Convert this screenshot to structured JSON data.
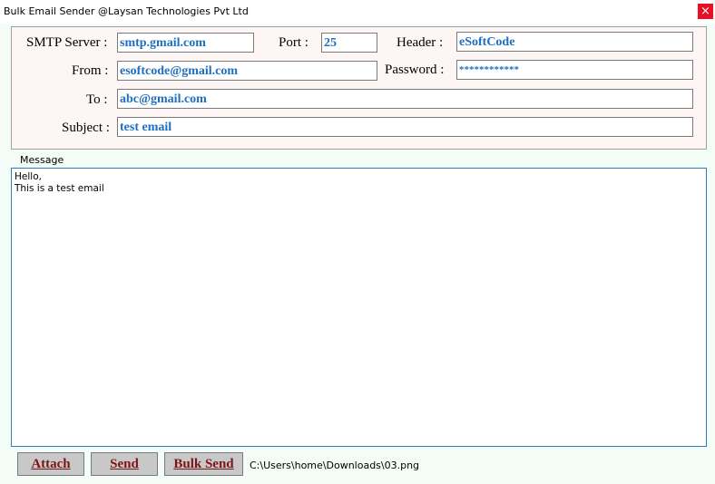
{
  "window": {
    "title": "Bulk Email Sender @Laysan Technologies Pvt Ltd",
    "close_glyph": "×"
  },
  "form": {
    "smtp_label": "SMTP Server :",
    "smtp_value": "smtp.gmail.com",
    "port_label": "Port :",
    "port_value": "25",
    "header_label": "Header :",
    "header_value": "eSoftCode",
    "from_label": "From :",
    "from_value": "esoftcode@gmail.com",
    "password_label": "Password :",
    "password_value": "************",
    "to_label": "To :",
    "to_value": "abc@gmail.com",
    "subject_label": "Subject :",
    "subject_value": "test email"
  },
  "message": {
    "label": "Message",
    "body": "Hello,\nThis is a test email"
  },
  "buttons": {
    "attach": "Attach",
    "send": "Send",
    "bulk_send": "Bulk Send"
  },
  "attachment_path": "C:\\Users\\home\\Downloads\\03.png",
  "colors": {
    "field_text": "#1f6fc0",
    "button_text": "#7b1416",
    "close_bg": "#e81123",
    "panel_bg": "#fdf6f4",
    "window_bg": "#f3fcf7"
  }
}
